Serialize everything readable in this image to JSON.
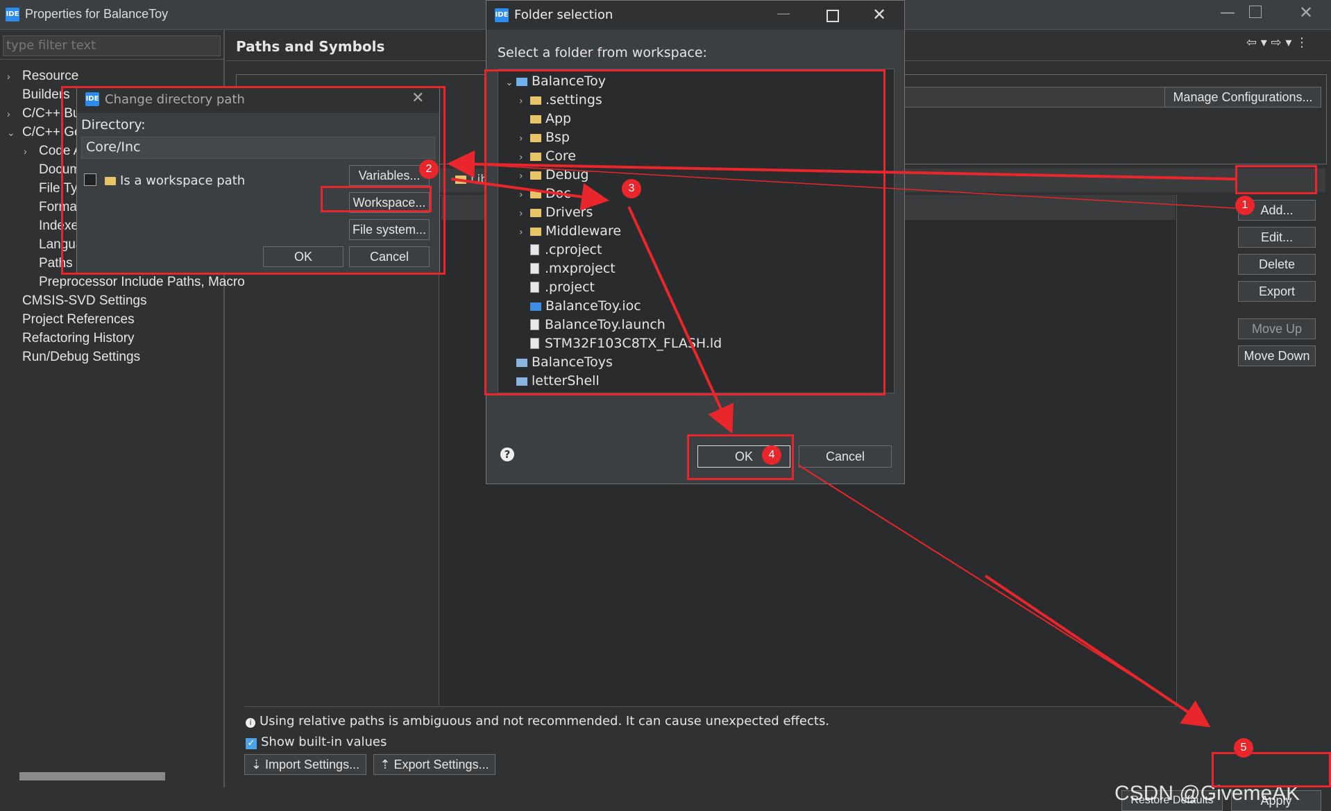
{
  "window": {
    "title": "Properties for BalanceToy",
    "filter_placeholder": "type filter text",
    "page_title": "Paths and Symbols"
  },
  "left_tree": [
    "Resource",
    "Builders",
    "C/C++ Build",
    "C/C++ General",
    "Code Analysis",
    "Documentation",
    "File Types",
    "Formatter",
    "Indexer",
    "Language Mappings",
    "Paths and Symbols",
    "Preprocessor Include Paths, Macros etc.",
    "CMSIS-SVD Settings",
    "Project References",
    "Refactoring History",
    "Run/Debug Settings"
  ],
  "right_buttons": {
    "manage": "Manage Configurations...",
    "add": "Add...",
    "edit": "Edit...",
    "delete": "Delete",
    "export": "Export",
    "move_up": "Move Up",
    "move_down": "Move Down"
  },
  "bottom": {
    "info": "Using relative paths is ambiguous and not recommended. It can cause unexpected effects.",
    "show_builtin": "Show built-in values",
    "import": "Import Settings...",
    "export": "Export Settings...",
    "restore": "Restore Defaults",
    "apply": "Apply",
    "watermark": "CSDN @GivemeAK"
  },
  "change_dir_dialog": {
    "title": "Change directory path",
    "directory_label": "Directory:",
    "directory_value": "Core/Inc",
    "workspace_checkbox": "Is a workspace path",
    "variables": "Variables...",
    "workspace": "Workspace...",
    "file_system": "File system...",
    "ok": "OK",
    "cancel": "Cancel"
  },
  "folder_dialog": {
    "title": "Folder selection",
    "prompt": "Select a folder from workspace:",
    "tree": [
      {
        "label": "BalanceToy",
        "type": "project",
        "level": 0,
        "chev": "open"
      },
      {
        "label": ".settings",
        "type": "folder",
        "level": 1,
        "chev": "closed"
      },
      {
        "label": "App",
        "type": "folder",
        "level": 1,
        "chev": "none"
      },
      {
        "label": "Bsp",
        "type": "folder",
        "level": 1,
        "chev": "closed"
      },
      {
        "label": "Core",
        "type": "folder",
        "level": 1,
        "chev": "closed"
      },
      {
        "label": "Debug",
        "type": "folder",
        "level": 1,
        "chev": "closed"
      },
      {
        "label": "Doc",
        "type": "folder",
        "level": 1,
        "chev": "closed"
      },
      {
        "label": "Drivers",
        "type": "folder",
        "level": 1,
        "chev": "closed"
      },
      {
        "label": "Middleware",
        "type": "folder",
        "level": 1,
        "chev": "closed"
      },
      {
        "label": ".cproject",
        "type": "file",
        "level": 1,
        "chev": "none"
      },
      {
        "label": ".mxproject",
        "type": "file",
        "level": 1,
        "chev": "none"
      },
      {
        "label": ".project",
        "type": "file",
        "level": 1,
        "chev": "none"
      },
      {
        "label": "BalanceToy.ioc",
        "type": "ioc",
        "level": 1,
        "chev": "none"
      },
      {
        "label": "BalanceToy.launch",
        "type": "file",
        "level": 1,
        "chev": "none"
      },
      {
        "label": "STM32F103C8TX_FLASH.ld",
        "type": "file",
        "level": 1,
        "chev": "none"
      },
      {
        "label": "BalanceToys",
        "type": "closed-project",
        "level": 0,
        "chev": "none"
      },
      {
        "label": "letterShell",
        "type": "closed-project",
        "level": 0,
        "chev": "none"
      }
    ],
    "ok": "OK",
    "cancel": "Cancel"
  },
  "annotations": [
    "1",
    "2",
    "3",
    "4",
    "5"
  ],
  "colors": {
    "accent_red": "#e8262b",
    "bg": "#2f3133",
    "panel": "#3c3f41"
  }
}
